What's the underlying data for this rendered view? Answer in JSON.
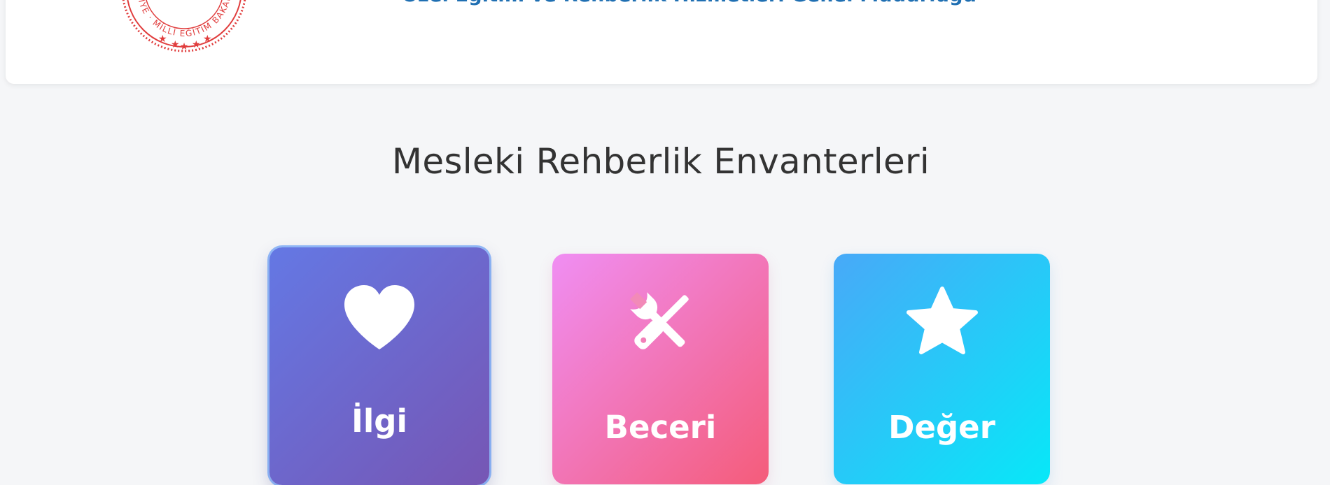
{
  "header": {
    "subtitle": "Özel Eğitim ve Rehberlik Hizmetleri Genel Müdürlüğü",
    "logo_text": "TÜRKİYE · MİLLÎ EĞİTİM BAKANLIĞI",
    "logo_color": "#e03c3c"
  },
  "main": {
    "title": "Mesleki Rehberlik Envanterleri",
    "cards": [
      {
        "label": "İlgi",
        "icon": "heart-icon"
      },
      {
        "label": "Beceri",
        "icon": "tools-icon"
      },
      {
        "label": "Değer",
        "icon": "star-icon"
      }
    ]
  },
  "colors": {
    "subtitle": "#1f6fb2",
    "ilgi_gradient": [
      "#6478e4",
      "#7656b4"
    ],
    "beceri_gradient": [
      "#f08ef3",
      "#f45c7a"
    ],
    "deger_gradient": [
      "#48a9f8",
      "#07e8f8"
    ]
  }
}
